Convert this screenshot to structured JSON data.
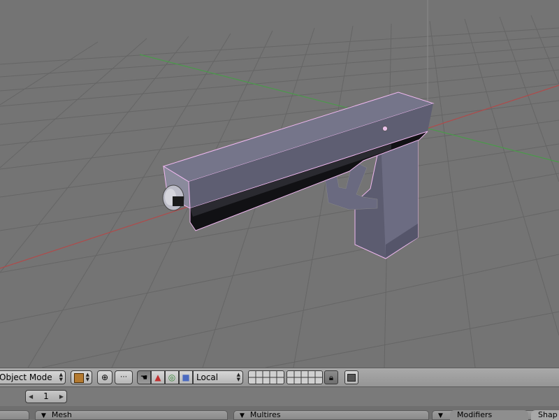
{
  "header": {
    "mode_label": "Object Mode",
    "orientation_label": "Local"
  },
  "frame": {
    "current": "1"
  },
  "panels": [
    {
      "label": "Mesh"
    },
    {
      "label": "Multires"
    }
  ],
  "tabs": [
    {
      "label": "Modifiers"
    },
    {
      "label": "Shap"
    }
  ],
  "icons": {
    "object": "cube-object-icon",
    "pivot": "pivot-crosshair-icon",
    "snap": "snap-dots-icon",
    "hand": "hand-icon",
    "translate": "translate-triangle-icon",
    "rotate": "rotate-circle-icon",
    "scale": "scale-square-icon",
    "lock": "lock-icon",
    "render": "render-icon"
  },
  "colors": {
    "viewport_bg": "#747474",
    "grid": "#6a6a6a",
    "x_axis": "#b04848",
    "y_axis": "#48a048",
    "selection_outline": "#f0b8f0",
    "mesh_face": "#6a6a80"
  }
}
